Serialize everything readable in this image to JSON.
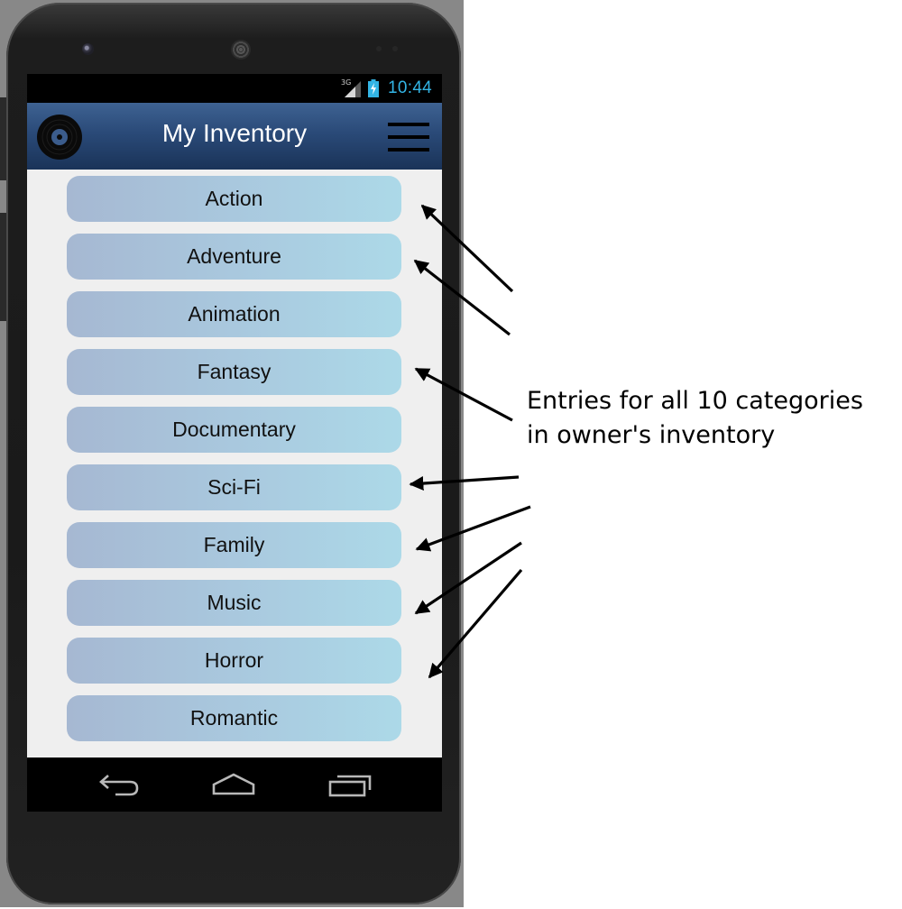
{
  "status_bar": {
    "network": "3G",
    "time": "10:44",
    "time_color": "#33b5e5"
  },
  "action_bar": {
    "title": "My Inventory",
    "logo_icon": "vinyl-disc-icon",
    "menu_icon": "hamburger-menu-icon",
    "colors": {
      "top": "#3e6292",
      "bottom": "#1a3358"
    }
  },
  "categories": [
    "Action",
    "Adventure",
    "Animation",
    "Fantasy",
    "Documentary",
    "Sci-Fi",
    "Family",
    "Music",
    "Horror",
    "Romantic"
  ],
  "category_button_colors": {
    "left": "#a6b8d2",
    "right": "#acd9e8"
  },
  "nav_bar": {
    "icons": [
      "back-icon",
      "home-icon",
      "recent-apps-icon"
    ]
  },
  "annotation": {
    "line1": "Entries for all 10 categories",
    "line2": "in owner's inventory"
  }
}
